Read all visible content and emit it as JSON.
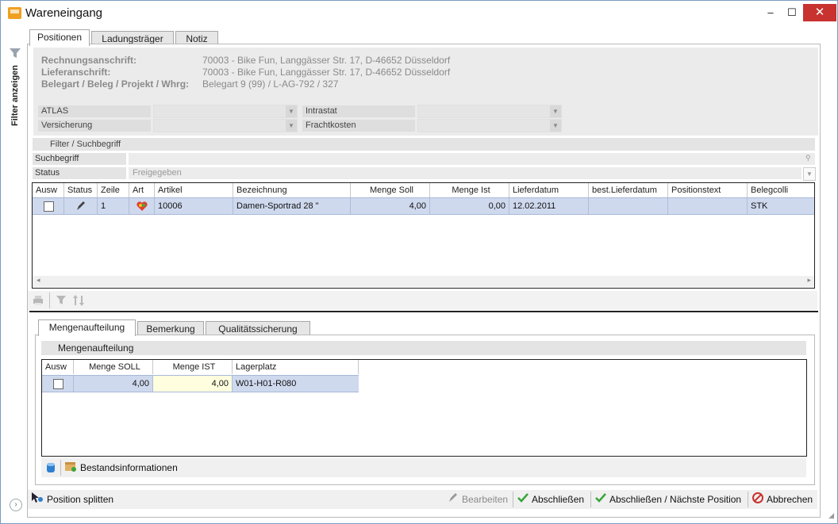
{
  "window": {
    "title": "Wareneingang",
    "minimize": "–",
    "maximize": "☐",
    "close": "✕"
  },
  "left_panel": {
    "filter_label": "Filter anzeigen"
  },
  "tabs": [
    {
      "label": "Positionen"
    },
    {
      "label": "Ladungsträger"
    },
    {
      "label": "Notiz"
    }
  ],
  "header": {
    "rechnung_label": "Rechnungsanschrift:",
    "rechnung_value": "70003 - Bike  Fun, Langgässer Str. 17, D-46652 Düsseldorf",
    "liefer_label": "Lieferanschrift:",
    "liefer_value": "70003 - Bike  Fun, Langgässer Str. 17, D-46652 Düsseldorf",
    "beleg_label": "Belegart / Beleg / Projekt / Whrg:",
    "beleg_value": "Belegart 9 (99) / L-AG-792 / 327",
    "atlas_label": "ATLAS",
    "intrastat_label": "Intrastat",
    "versicherung_label": "Versicherung",
    "frachtkosten_label": "Frachtkosten"
  },
  "filter": {
    "section_label": "Filter / Suchbegriff",
    "search_label": "Suchbegriff",
    "search_value": "",
    "status_label": "Status",
    "status_value": "Freigegeben"
  },
  "positions_grid": {
    "columns": [
      "Ausw",
      "Status",
      "Zeile",
      "Art",
      "Artikel",
      "Bezeichnung",
      "Menge Soll",
      "Menge Ist",
      "Lieferdatum",
      "best.Lieferdatum",
      "Positionstext",
      "Belegcolli"
    ],
    "rows": [
      {
        "zeile": "1",
        "artikel": "10006",
        "bezeichnung": "Damen-Sportrad 28 \"",
        "menge_soll": "4,00",
        "menge_ist": "0,00",
        "lieferdatum": "12.02.2011",
        "best_lieferdatum": "",
        "positionstext": "",
        "belegcolli": "STK"
      }
    ]
  },
  "subtabs": [
    {
      "label": "Mengenaufteilung"
    },
    {
      "label": "Bemerkung"
    },
    {
      "label": "Qualitätssicherung"
    }
  ],
  "mengen": {
    "section_label": "Mengenaufteilung",
    "columns": [
      "Ausw",
      "Menge SOLL",
      "Menge IST",
      "Lagerplatz"
    ],
    "rows": [
      {
        "menge_soll": "4,00",
        "menge_ist": "4,00",
        "lagerplatz": "W01-H01-R080"
      }
    ],
    "bestand_button": "Bestandsinformationen"
  },
  "footer": {
    "split": "Position splitten",
    "bearbeiten": "Bearbeiten",
    "abschliessen": "Abschließen",
    "abschliessen_next": "Abschließen / Nächste Position",
    "abbrechen": "Abbrechen"
  },
  "colors": {
    "selection": "#cfd9ee",
    "accent": "#c8322f",
    "check": "#3aa53a",
    "highlight_cell": "#ffffe0"
  }
}
